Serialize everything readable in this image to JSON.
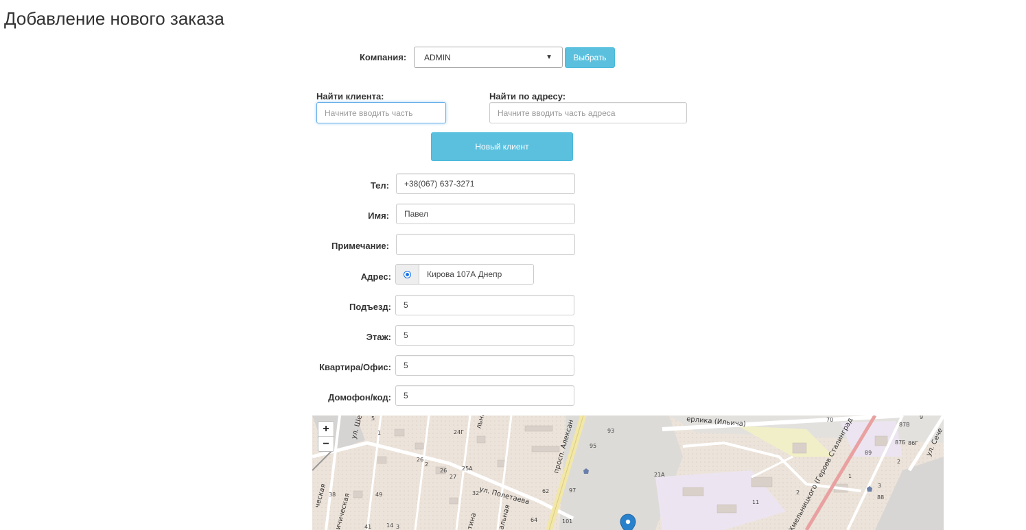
{
  "page": {
    "title": "Добавление нового заказа"
  },
  "company": {
    "label": "Компания:",
    "selected": "ADMIN",
    "choose_button": "Выбрать"
  },
  "search": {
    "client_label": "Найти клиента:",
    "client_placeholder": "Начните вводить часть",
    "address_label": "Найти по адресу:",
    "address_placeholder": "Начните вводить часть адреса"
  },
  "new_client_button": "Новый клиент",
  "form": {
    "phone": {
      "label": "Тел:",
      "value": "+38(067) 637-3271"
    },
    "name": {
      "label": "Имя:",
      "value": "Павел"
    },
    "note": {
      "label": "Примечание:",
      "value": ""
    },
    "address": {
      "label": "Адрес:",
      "value": "Кирова 107А Днепр"
    },
    "entrance": {
      "label": "Подъезд:",
      "value": "5"
    },
    "floor": {
      "label": "Этаж:",
      "value": "5"
    },
    "apartment": {
      "label": "Квартира/Офис:",
      "value": "5"
    },
    "intercom": {
      "label": "Домофон/код:",
      "value": "5"
    }
  },
  "map": {
    "zoom_in": "+",
    "zoom_out": "−",
    "streets": [
      "просп. Алексан",
      "ул. Полетаева",
      "ерлика (Ильича)",
      "Хмельницкого (Героев Сталинград",
      "ул. Сече",
      "ул. Шев",
      "ческая",
      "ичическая",
      "альная",
      "тина",
      "льна"
    ],
    "house_numbers": [
      "5",
      "1",
      "24Г",
      "26",
      "2",
      "26",
      "27",
      "25А",
      "32",
      "38",
      "49",
      "41",
      "14",
      "3",
      "62",
      "64",
      "97",
      "93",
      "95",
      "101",
      "21А",
      "70",
      "87В",
      "9",
      "89",
      "87Б",
      "86Г",
      "2",
      "1",
      "3",
      "88",
      "2",
      "11"
    ],
    "marker_icon": "map-marker-icon",
    "colors": {
      "park": "#f1efc7",
      "residential": "#ece5f1",
      "major_road": "#f2e7a6"
    }
  }
}
